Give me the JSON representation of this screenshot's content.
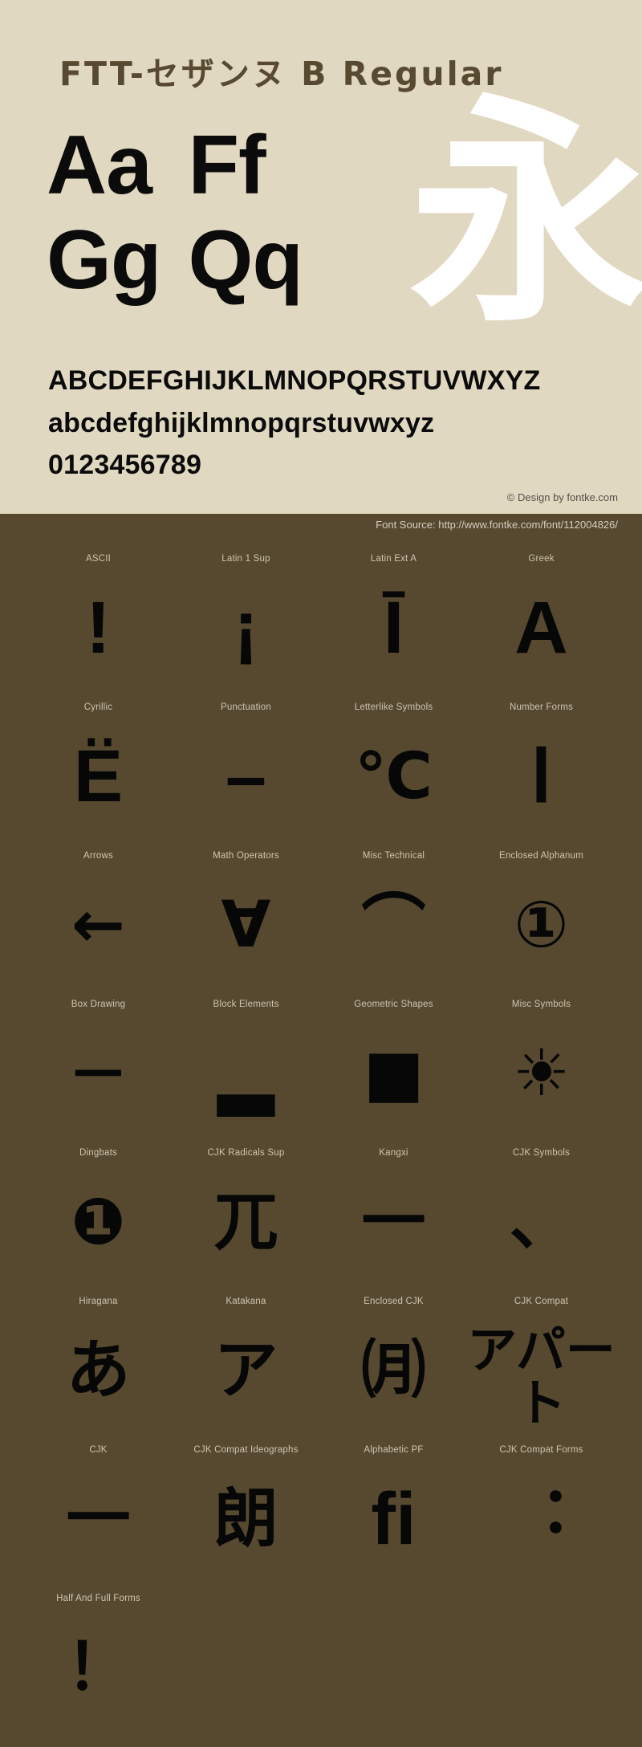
{
  "page": {
    "background_dark": "#56492f",
    "background_light": "#e1d8c1",
    "glyph_color": "#070707",
    "title_color": "#574a31",
    "label_color": "#cdc5b3",
    "highlight_glyph_color": "#ffffff"
  },
  "header": {
    "font_title": "FTT-セザンヌ B Regular"
  },
  "specimen": {
    "big_rows": [
      {
        "cells": [
          "Aa",
          "Ff"
        ]
      },
      {
        "cells": [
          "Gg",
          "Qq"
        ]
      }
    ],
    "cjk_sample": "永",
    "uppercase": "ABCDEFGHIJKLMNOPQRSTUVWXYZ",
    "lowercase": "abcdefghijklmnopqrstuvwxyz",
    "digits": "0123456789",
    "credit": "© Design by fontke.com",
    "source": "Font Source: http://www.fontke.com/font/112004826/"
  },
  "blocks": [
    [
      {
        "label": "ASCII",
        "glyph": "!",
        "style": "latin"
      },
      {
        "label": "Latin 1 Sup",
        "glyph": "¡",
        "style": "latin"
      },
      {
        "label": "Latin Ext A",
        "glyph": "Ī",
        "style": "latin"
      },
      {
        "label": "Greek",
        "glyph": "Α",
        "style": "latin"
      }
    ],
    [
      {
        "label": "Cyrillic",
        "glyph": "Ё",
        "style": "latin"
      },
      {
        "label": "Punctuation",
        "glyph": "–",
        "style": "latin"
      },
      {
        "label": "Letterlike Symbols",
        "glyph": "℃",
        "style": "wide"
      },
      {
        "label": "Number Forms",
        "glyph": "Ⅰ",
        "style": "latin"
      }
    ],
    [
      {
        "label": "Arrows",
        "glyph": "←",
        "style": "wide"
      },
      {
        "label": "Math Operators",
        "glyph": "∀",
        "style": "wide"
      },
      {
        "label": "Misc Technical",
        "glyph": "⌒",
        "style": "wide"
      },
      {
        "label": "Enclosed Alphanum",
        "glyph": "①",
        "style": "wide"
      }
    ],
    [
      {
        "label": "Box Drawing",
        "glyph": "─",
        "style": "thin-line"
      },
      {
        "label": "Block Elements",
        "glyph": "▂",
        "style": "thin-line"
      },
      {
        "label": "Geometric Shapes",
        "glyph": "■",
        "style": "wide"
      },
      {
        "label": "Misc Symbols",
        "glyph": "☀",
        "style": "wide"
      }
    ],
    [
      {
        "label": "Dingbats",
        "glyph": "❶",
        "style": "wide"
      },
      {
        "label": "CJK Radicals Sup",
        "glyph": "兀",
        "style": "wide"
      },
      {
        "label": "Kangxi",
        "glyph": "一",
        "style": "wide"
      },
      {
        "label": "CJK Symbols",
        "glyph": "、",
        "style": "wide"
      }
    ],
    [
      {
        "label": "Hiragana",
        "glyph": "あ",
        "style": "wide"
      },
      {
        "label": "Katakana",
        "glyph": "ア",
        "style": "wide"
      },
      {
        "label": "Enclosed CJK",
        "glyph": "㈪",
        "style": "wide"
      },
      {
        "label": "CJK Compat",
        "glyph": "アパート",
        "style": "small-stack"
      }
    ],
    [
      {
        "label": "CJK",
        "glyph": "一",
        "style": "wide"
      },
      {
        "label": "CJK Compat Ideographs",
        "glyph": "朗",
        "style": "wide"
      },
      {
        "label": "Alphabetic PF",
        "glyph": "ﬁ",
        "style": "latin"
      },
      {
        "label": "CJK Compat Forms",
        "glyph": "︓",
        "style": "wide"
      }
    ],
    [
      {
        "label": "Half And Full Forms",
        "glyph": "！",
        "style": "wide"
      }
    ]
  ]
}
